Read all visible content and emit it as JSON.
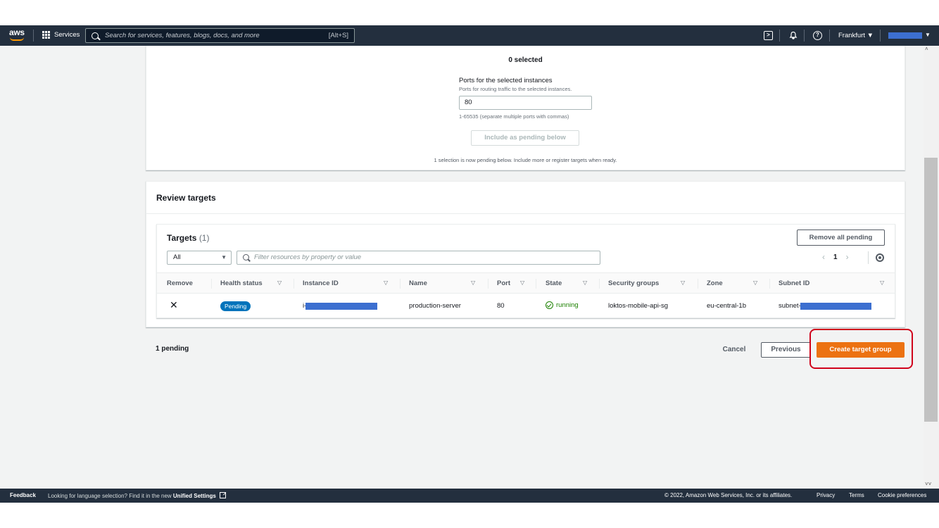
{
  "nav": {
    "logo": "aws",
    "services_label": "Services",
    "search_placeholder": "Search for services, features, blogs, docs, and more",
    "search_shortcut": "[Alt+S]",
    "region": "Frankfurt ▼"
  },
  "register": {
    "selected_count": "0 selected",
    "ports_label": "Ports for the selected instances",
    "ports_desc": "Ports for routing traffic to the selected instances.",
    "ports_value": "80",
    "ports_hint": "1-65535 (separate multiple ports with commas)",
    "include_button": "Include as pending below",
    "pending_note": "1 selection is now pending below. Include more or register targets when ready."
  },
  "review": {
    "title": "Review targets",
    "targets_title": "Targets",
    "targets_count": "(1)",
    "remove_all_button": "Remove all pending",
    "filter_select": "All",
    "filter_placeholder": "Filter resources by property or value",
    "page_number": "1",
    "columns": [
      "Remove",
      "Health status",
      "Instance ID",
      "Name",
      "Port",
      "State",
      "Security groups",
      "Zone",
      "Subnet ID"
    ],
    "rows": [
      {
        "health_status": "Pending",
        "instance_id_prefix": "i-",
        "name": "production-server",
        "port": "80",
        "state": "running",
        "security_groups": "loktos-mobile-api-sg",
        "zone": "eu-central-1b",
        "subnet_prefix": "subnet-"
      }
    ]
  },
  "actions": {
    "pending_count": "1 pending",
    "cancel": "Cancel",
    "previous": "Previous",
    "create": "Create target group"
  },
  "footer": {
    "feedback": "Feedback",
    "language_note": "Looking for language selection? Find it in the new",
    "unified_settings": "Unified Settings",
    "copyright": "© 2022, Amazon Web Services, Inc. or its affiliates.",
    "privacy": "Privacy",
    "terms": "Terms",
    "cookie": "Cookie preferences"
  },
  "colors": {
    "nav_bg": "#232f3e",
    "primary_button": "#ec7211",
    "pending_badge": "#0073bb",
    "running_green": "#1d8102",
    "highlight_red": "#d0021b",
    "redaction_blue": "#3c6fd0"
  }
}
